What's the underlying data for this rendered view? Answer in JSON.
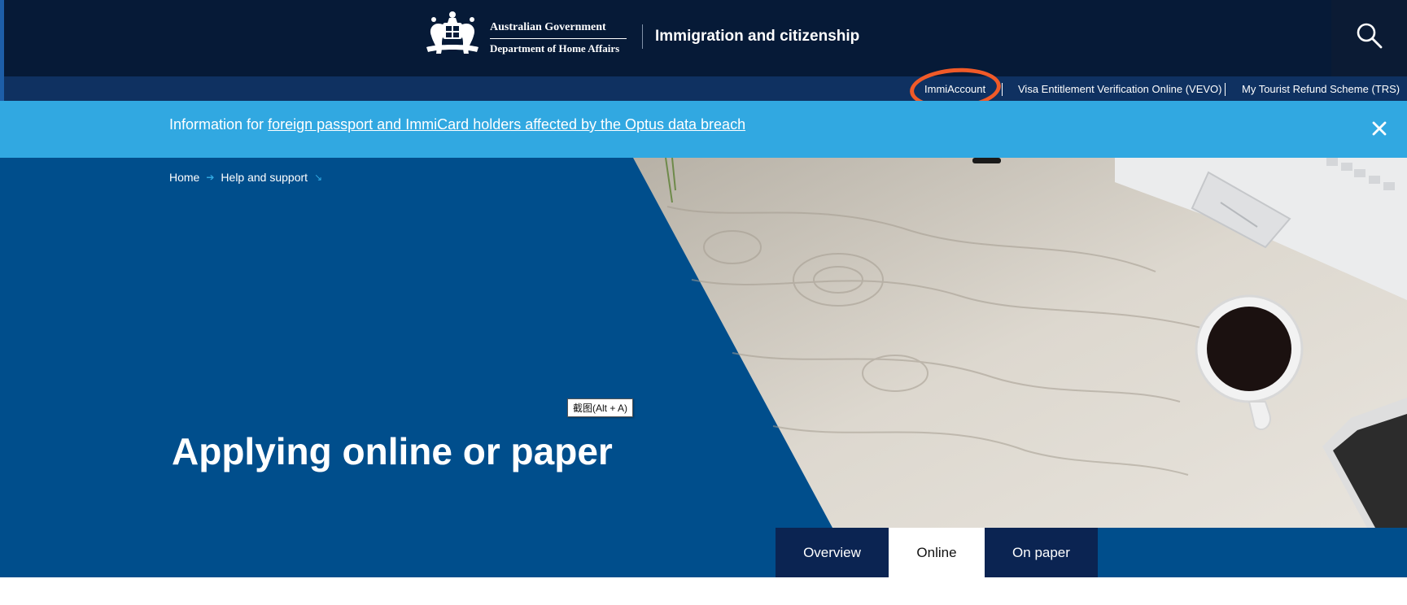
{
  "header": {
    "logo_line1": "Australian Government",
    "logo_line2": "Department of Home Affairs",
    "site_title": "Immigration and citizenship",
    "search_icon": "search-icon"
  },
  "utility_nav": {
    "links": [
      {
        "label": "ImmiAccount"
      },
      {
        "label": "Visa Entitlement Verification Online (VEVO)"
      },
      {
        "label": "My Tourist Refund Scheme (TRS)"
      }
    ]
  },
  "alert": {
    "prefix": "Information for",
    "link_text": "foreign passport and ImmiCard holders affected by the Optus data breach",
    "close_icon": "close-icon"
  },
  "breadcrumb": {
    "items": [
      {
        "label": "Home"
      },
      {
        "label": "Help and support"
      }
    ]
  },
  "hero": {
    "title": "Applying online or paper"
  },
  "tooltip": {
    "text": "截图(Alt + A)"
  },
  "tabs": [
    {
      "label": "Overview",
      "active": false
    },
    {
      "label": "Online",
      "active": true
    },
    {
      "label": "On paper",
      "active": false
    }
  ],
  "colors": {
    "header_bg": "#061a37",
    "utility_bg": "#0f3161",
    "alert_bg": "#31a8e1",
    "hero_bg": "#004e8c",
    "tab_bg": "#0b2452",
    "annotation": "#f05a28"
  }
}
